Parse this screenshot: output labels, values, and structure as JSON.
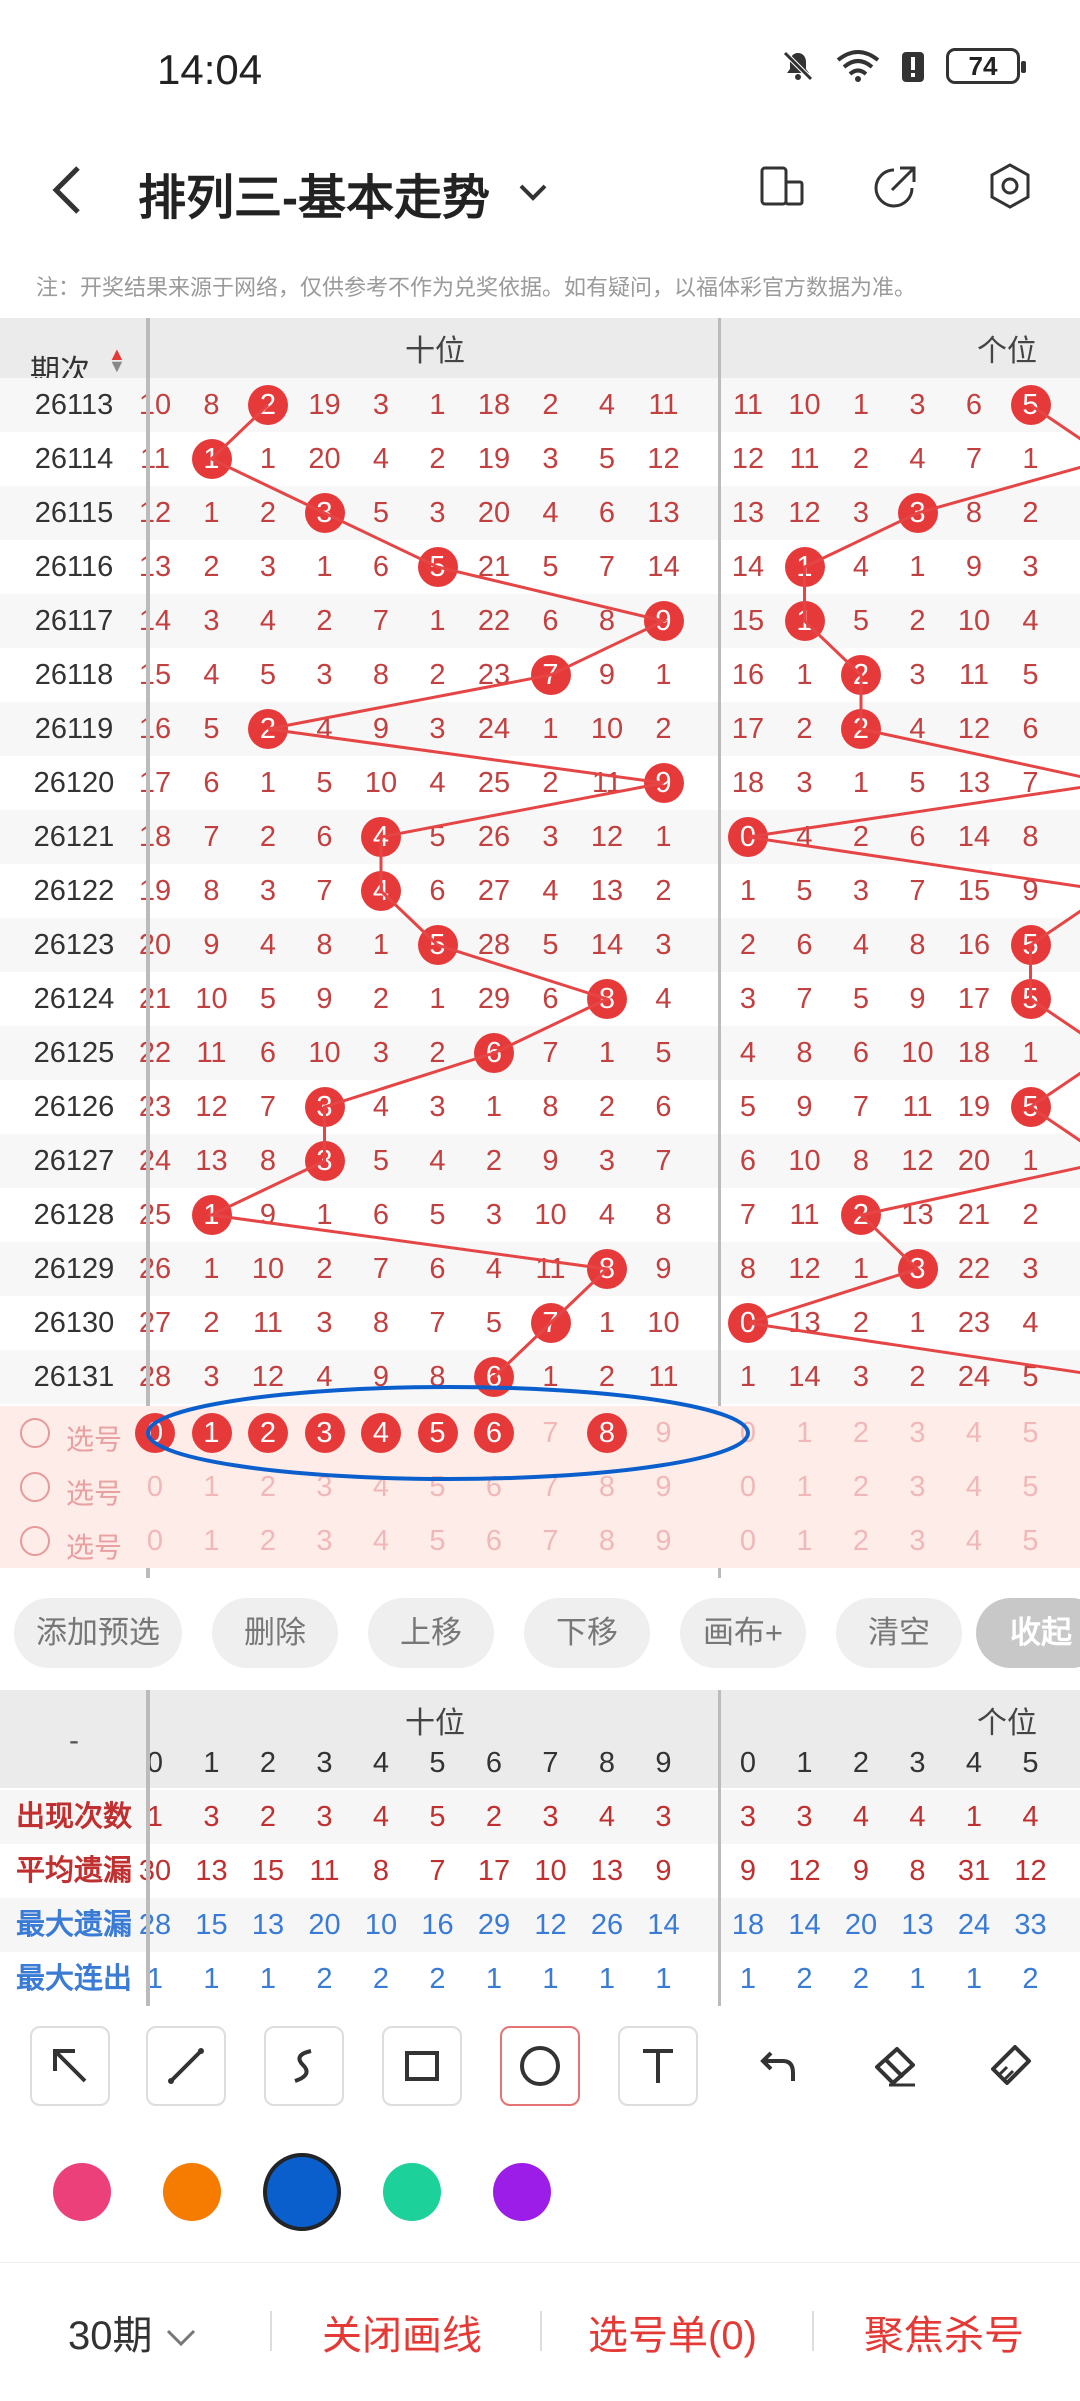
{
  "status": {
    "time": "14:04",
    "battery": "74"
  },
  "header": {
    "title": "排列三-基本走势"
  },
  "note": "注：开奖结果来源于网络，仅供参考不作为兑奖依据。如有疑问，以福体彩官方数据为准。",
  "chart": {
    "period_header": "期次",
    "group_tens": "十位",
    "group_units": "个位",
    "digits": [
      "0",
      "1",
      "2",
      "3",
      "4",
      "5",
      "6",
      "7",
      "8",
      "9"
    ],
    "rows": [
      {
        "period": "26113",
        "tens": [
          "10",
          "8",
          "2",
          "19",
          "3",
          "1",
          "18",
          "2",
          "4",
          "11"
        ],
        "units": [
          "11",
          "10",
          "1",
          "3",
          "6",
          "5"
        ],
        "hit_t": 2,
        "hit_u": 5
      },
      {
        "period": "26114",
        "tens": [
          "11",
          "1",
          "1",
          "20",
          "4",
          "2",
          "19",
          "3",
          "5",
          "12"
        ],
        "units": [
          "12",
          "11",
          "2",
          "4",
          "7",
          "1"
        ],
        "hit_t": 1,
        "hit_u": -1
      },
      {
        "period": "26115",
        "tens": [
          "12",
          "1",
          "2",
          "3",
          "5",
          "3",
          "20",
          "4",
          "6",
          "13"
        ],
        "units": [
          "13",
          "12",
          "3",
          "3",
          "8",
          "2"
        ],
        "hit_t": 3,
        "hit_u": 3
      },
      {
        "period": "26116",
        "tens": [
          "13",
          "2",
          "3",
          "1",
          "6",
          "5",
          "21",
          "5",
          "7",
          "14"
        ],
        "units": [
          "14",
          "1",
          "4",
          "1",
          "9",
          "3"
        ],
        "hit_t": 5,
        "hit_u": 1
      },
      {
        "period": "26117",
        "tens": [
          "14",
          "3",
          "4",
          "2",
          "7",
          "1",
          "22",
          "6",
          "8",
          "9"
        ],
        "units": [
          "15",
          "1",
          "5",
          "2",
          "10",
          "4"
        ],
        "hit_t": 9,
        "hit_u": 1
      },
      {
        "period": "26118",
        "tens": [
          "15",
          "4",
          "5",
          "3",
          "8",
          "2",
          "23",
          "7",
          "9",
          "1"
        ],
        "units": [
          "16",
          "1",
          "2",
          "3",
          "11",
          "5"
        ],
        "hit_t": 7,
        "hit_u": 2
      },
      {
        "period": "26119",
        "tens": [
          "16",
          "5",
          "2",
          "4",
          "9",
          "3",
          "24",
          "1",
          "10",
          "2"
        ],
        "units": [
          "17",
          "2",
          "2",
          "4",
          "12",
          "6"
        ],
        "hit_t": 2,
        "hit_u": 2
      },
      {
        "period": "26120",
        "tens": [
          "17",
          "6",
          "1",
          "5",
          "10",
          "4",
          "25",
          "2",
          "11",
          "9"
        ],
        "units": [
          "18",
          "3",
          "1",
          "5",
          "13",
          "7"
        ],
        "hit_t": 9,
        "hit_u": -1
      },
      {
        "period": "26121",
        "tens": [
          "18",
          "7",
          "2",
          "6",
          "4",
          "5",
          "26",
          "3",
          "12",
          "1"
        ],
        "units": [
          "0",
          "4",
          "2",
          "6",
          "14",
          "8"
        ],
        "hit_t": 4,
        "hit_u": 0
      },
      {
        "period": "26122",
        "tens": [
          "19",
          "8",
          "3",
          "7",
          "4",
          "6",
          "27",
          "4",
          "13",
          "2"
        ],
        "units": [
          "1",
          "5",
          "3",
          "7",
          "15",
          "9"
        ],
        "hit_t": 4,
        "hit_u": -1
      },
      {
        "period": "26123",
        "tens": [
          "20",
          "9",
          "4",
          "8",
          "1",
          "5",
          "28",
          "5",
          "14",
          "3"
        ],
        "units": [
          "2",
          "6",
          "4",
          "8",
          "16",
          "5"
        ],
        "hit_t": 5,
        "hit_u": 5
      },
      {
        "period": "26124",
        "tens": [
          "21",
          "10",
          "5",
          "9",
          "2",
          "1",
          "29",
          "6",
          "8",
          "4"
        ],
        "units": [
          "3",
          "7",
          "5",
          "9",
          "17",
          "5"
        ],
        "hit_t": 8,
        "hit_u": 5
      },
      {
        "period": "26125",
        "tens": [
          "22",
          "11",
          "6",
          "10",
          "3",
          "2",
          "6",
          "7",
          "1",
          "5"
        ],
        "units": [
          "4",
          "8",
          "6",
          "10",
          "18",
          "1"
        ],
        "hit_t": 6,
        "hit_u": -1
      },
      {
        "period": "26126",
        "tens": [
          "23",
          "12",
          "7",
          "3",
          "4",
          "3",
          "1",
          "8",
          "2",
          "6"
        ],
        "units": [
          "5",
          "9",
          "7",
          "11",
          "19",
          "5"
        ],
        "hit_t": 3,
        "hit_u": 5
      },
      {
        "period": "26127",
        "tens": [
          "24",
          "13",
          "8",
          "3",
          "5",
          "4",
          "2",
          "9",
          "3",
          "7"
        ],
        "units": [
          "6",
          "10",
          "8",
          "12",
          "20",
          "1"
        ],
        "hit_t": 3,
        "hit_u": -1
      },
      {
        "period": "26128",
        "tens": [
          "25",
          "1",
          "9",
          "1",
          "6",
          "5",
          "3",
          "10",
          "4",
          "8"
        ],
        "units": [
          "7",
          "11",
          "2",
          "13",
          "21",
          "2"
        ],
        "hit_t": 1,
        "hit_u": 2
      },
      {
        "period": "26129",
        "tens": [
          "26",
          "1",
          "10",
          "2",
          "7",
          "6",
          "4",
          "11",
          "8",
          "9"
        ],
        "units": [
          "8",
          "12",
          "1",
          "3",
          "22",
          "3"
        ],
        "hit_t": 8,
        "hit_u": 3
      },
      {
        "period": "26130",
        "tens": [
          "27",
          "2",
          "11",
          "3",
          "8",
          "7",
          "5",
          "7",
          "1",
          "10"
        ],
        "units": [
          "0",
          "13",
          "2",
          "1",
          "23",
          "4"
        ],
        "hit_t": 7,
        "hit_u": 0
      },
      {
        "period": "26131",
        "tens": [
          "28",
          "3",
          "12",
          "4",
          "9",
          "8",
          "6",
          "1",
          "2",
          "11"
        ],
        "units": [
          "1",
          "14",
          "3",
          "2",
          "24",
          "5"
        ],
        "hit_t": 6,
        "hit_u": -1
      }
    ],
    "pick_label": "选号",
    "pick_digits_units": [
      "0",
      "1",
      "2",
      "3",
      "4",
      "5"
    ]
  },
  "toolbar": [
    "添加预选",
    "删除",
    "上移",
    "下移",
    "画布+",
    "清空",
    "收起"
  ],
  "stats": {
    "dash": "-",
    "rows": [
      {
        "label": "出现次数",
        "tens": [
          "1",
          "3",
          "2",
          "3",
          "4",
          "5",
          "2",
          "3",
          "4",
          "3"
        ],
        "units": [
          "3",
          "3",
          "4",
          "4",
          "1",
          "4"
        ],
        "color": "#c03030"
      },
      {
        "label": "平均遗漏",
        "tens": [
          "30",
          "13",
          "15",
          "11",
          "8",
          "7",
          "17",
          "10",
          "13",
          "9"
        ],
        "units": [
          "9",
          "12",
          "9",
          "8",
          "31",
          "12"
        ],
        "color": "#c03030"
      },
      {
        "label": "最大遗漏",
        "tens": [
          "28",
          "15",
          "13",
          "20",
          "10",
          "16",
          "29",
          "12",
          "26",
          "14"
        ],
        "units": [
          "18",
          "14",
          "20",
          "13",
          "24",
          "33"
        ],
        "color": "#3a7bd5"
      },
      {
        "label": "最大连出",
        "tens": [
          "1",
          "1",
          "1",
          "2",
          "2",
          "2",
          "1",
          "1",
          "1",
          "1"
        ],
        "units": [
          "1",
          "2",
          "2",
          "1",
          "1",
          "2"
        ],
        "color": "#3a7bd5"
      }
    ]
  },
  "colors": [
    "#ec407a",
    "#f57c00",
    "#0a5fcc",
    "#1dd19a",
    "#9c1de8"
  ],
  "bottom": {
    "periods": "30期",
    "close_lines": "关闭画线",
    "pick_list": "选号单(0)",
    "focus_kill": "聚焦杀号"
  }
}
